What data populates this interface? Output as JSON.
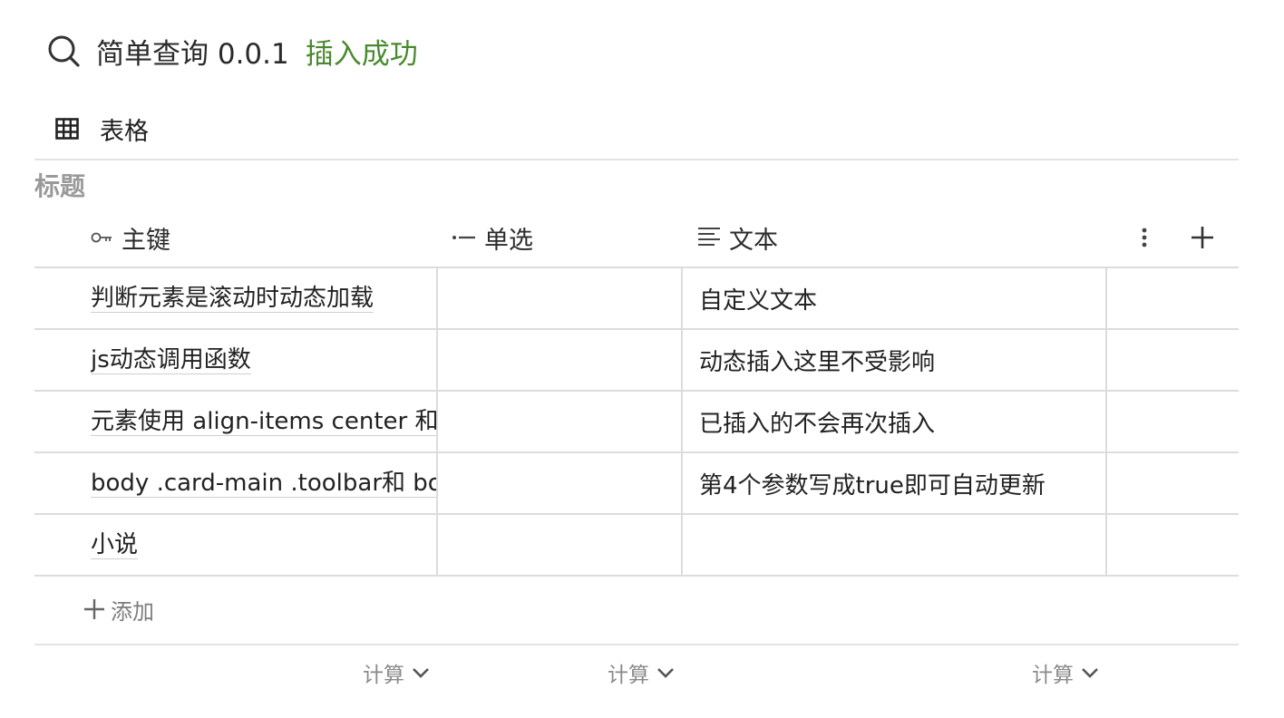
{
  "header": {
    "title": "简单查询 0.0.1",
    "status": "插入成功",
    "status_color": "#4a8a2e",
    "icon": "search-icon"
  },
  "view": {
    "tab_label": "表格",
    "icon": "table-grid-icon"
  },
  "table": {
    "title": "标题",
    "columns": [
      {
        "label": "主键",
        "icon": "key-icon"
      },
      {
        "label": "单选",
        "icon": "single-select-icon"
      },
      {
        "label": "文本",
        "icon": "text-lines-icon"
      }
    ],
    "rows": [
      {
        "key": "判断元素是滚动时动态加载",
        "select": "",
        "text": "自定义文本"
      },
      {
        "key": "js动态调用函数",
        "select": "",
        "text": "动态插入这里不受影响"
      },
      {
        "key": "元素使用 align-items center 和",
        "select": "",
        "text": "已插入的不会再次插入"
      },
      {
        "key": "body .card-main .toolbar和 boc",
        "select": "",
        "text": "第4个参数写成true即可自动更新"
      },
      {
        "key": "小说",
        "select": "",
        "text": ""
      }
    ],
    "add_label": "添加",
    "calc_labels": [
      "计算",
      "计算",
      "计算"
    ]
  }
}
